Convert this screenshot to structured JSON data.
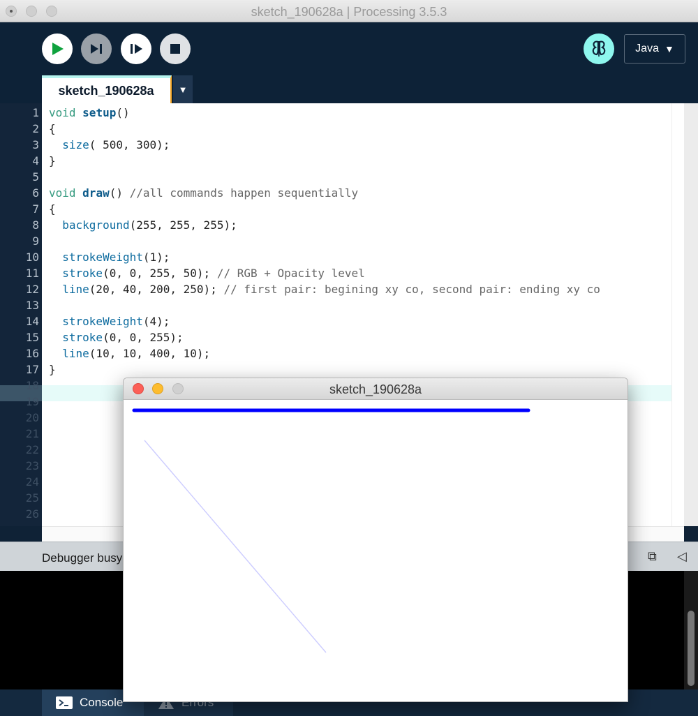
{
  "window": {
    "title": "sketch_190628a | Processing 3.5.3"
  },
  "toolbar": {
    "run_icon": "play-icon",
    "step_icon": "step-icon",
    "continue_icon": "continue-icon",
    "stop_icon": "stop-icon",
    "mode_icon": "debugger-butterfly-icon",
    "mode_label": "Java",
    "mode_arrow": "▼"
  },
  "tabs": {
    "active": "sketch_190628a",
    "menu_arrow": "▼"
  },
  "editor": {
    "highlighted_line": 12,
    "line_numbers": [
      "1",
      "2",
      "3",
      "4",
      "5",
      "6",
      "7",
      "8",
      "9",
      "10",
      "11",
      "12",
      "13",
      "14",
      "15",
      "16",
      "17",
      "18",
      "19",
      "20",
      "21",
      "22",
      "23",
      "24",
      "25",
      "26"
    ],
    "code": [
      [
        {
          "t": "void",
          "c": "kw"
        },
        {
          "t": " "
        },
        {
          "t": "setup",
          "c": "fn"
        },
        {
          "t": "()"
        }
      ],
      [
        {
          "t": "{"
        }
      ],
      [
        {
          "t": "  "
        },
        {
          "t": "size",
          "c": "bi"
        },
        {
          "t": "( 500, 300);"
        }
      ],
      [
        {
          "t": "}"
        }
      ],
      [],
      [
        {
          "t": "void",
          "c": "kw"
        },
        {
          "t": " "
        },
        {
          "t": "draw",
          "c": "fn"
        },
        {
          "t": "() "
        },
        {
          "t": "//all commands happen sequentially",
          "c": "cm"
        }
      ],
      [
        {
          "t": "{"
        }
      ],
      [
        {
          "t": "  "
        },
        {
          "t": "background",
          "c": "bi"
        },
        {
          "t": "(255, 255, 255);"
        }
      ],
      [],
      [
        {
          "t": "  "
        },
        {
          "t": "strokeWeight",
          "c": "bi"
        },
        {
          "t": "(1);"
        }
      ],
      [
        {
          "t": "  "
        },
        {
          "t": "stroke",
          "c": "bi"
        },
        {
          "t": "(0, 0, 255, 50); "
        },
        {
          "t": "// RGB + Opacity level",
          "c": "cm"
        }
      ],
      [
        {
          "t": "  "
        },
        {
          "t": "line",
          "c": "bi"
        },
        {
          "t": "(20, 40, 200, 250); "
        },
        {
          "t": "// first pair: begining xy co, second pair: ending xy co",
          "c": "cm"
        }
      ],
      [],
      [
        {
          "t": "  "
        },
        {
          "t": "strokeWeight",
          "c": "bi"
        },
        {
          "t": "(4);"
        }
      ],
      [
        {
          "t": "  "
        },
        {
          "t": "stroke",
          "c": "bi"
        },
        {
          "t": "(0, 0, 255);"
        }
      ],
      [
        {
          "t": "  "
        },
        {
          "t": "line",
          "c": "bi"
        },
        {
          "t": "(10, 10, 400, 10);"
        }
      ],
      [
        {
          "t": "}"
        }
      ]
    ]
  },
  "console": {
    "status": "Debugger busy",
    "copy_icon": "copy-icon",
    "collapse_icon": "collapse-arrow-icon",
    "tab_console": "Console",
    "tab_errors": "Errors",
    "console_icon": "terminal-icon",
    "errors_icon": "warning-icon"
  },
  "sketch_window": {
    "title": "sketch_190628a",
    "stroke_color": "#0000ff",
    "background": "#ffffff"
  },
  "colors": {
    "toolbar_bg": "#0d2237",
    "run_green": "#0fa23e",
    "mode_cyan": "#8ef7ee",
    "highlight_line": "#e6fbf9"
  }
}
